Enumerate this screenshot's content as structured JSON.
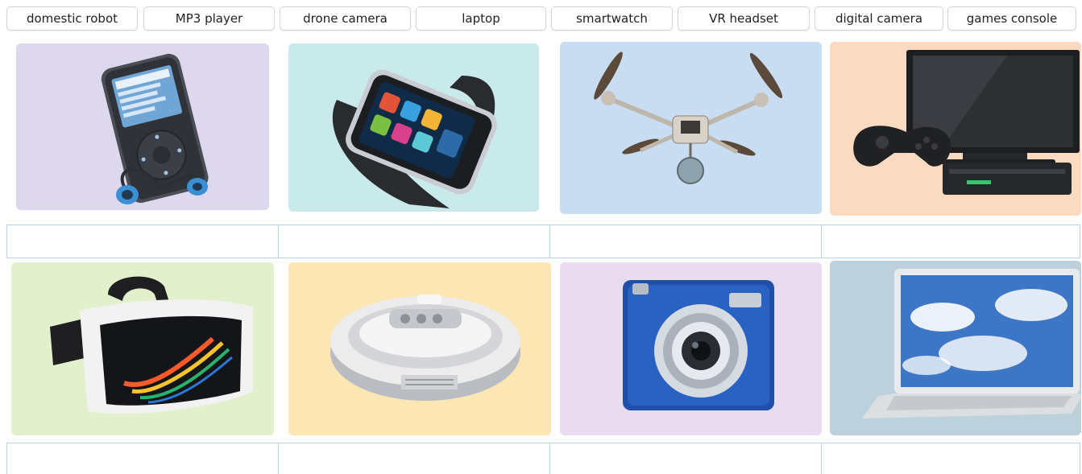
{
  "word_bank": {
    "words": [
      "domestic robot",
      "MP3 player",
      "drone camera",
      "laptop",
      "smartwatch",
      "VR headset",
      "digital camera",
      "games console"
    ]
  },
  "tiles": [
    {
      "device": "mp3-player",
      "bg": "#ddd8ee"
    },
    {
      "device": "smartwatch",
      "bg": "#c9eaea"
    },
    {
      "device": "drone-camera",
      "bg": "#c8dcf2"
    },
    {
      "device": "games-console",
      "bg": "#fadac0"
    },
    {
      "device": "vr-headset",
      "bg": "#e2f0cc"
    },
    {
      "device": "domestic-robot",
      "bg": "#fbe6b4"
    },
    {
      "device": "digital-camera",
      "bg": "#eadcf0"
    },
    {
      "device": "laptop",
      "bg": "#bcd1db"
    }
  ],
  "answers": {
    "row1": [
      "",
      "",
      "",
      ""
    ],
    "row2": [
      "",
      "",
      "",
      ""
    ]
  }
}
